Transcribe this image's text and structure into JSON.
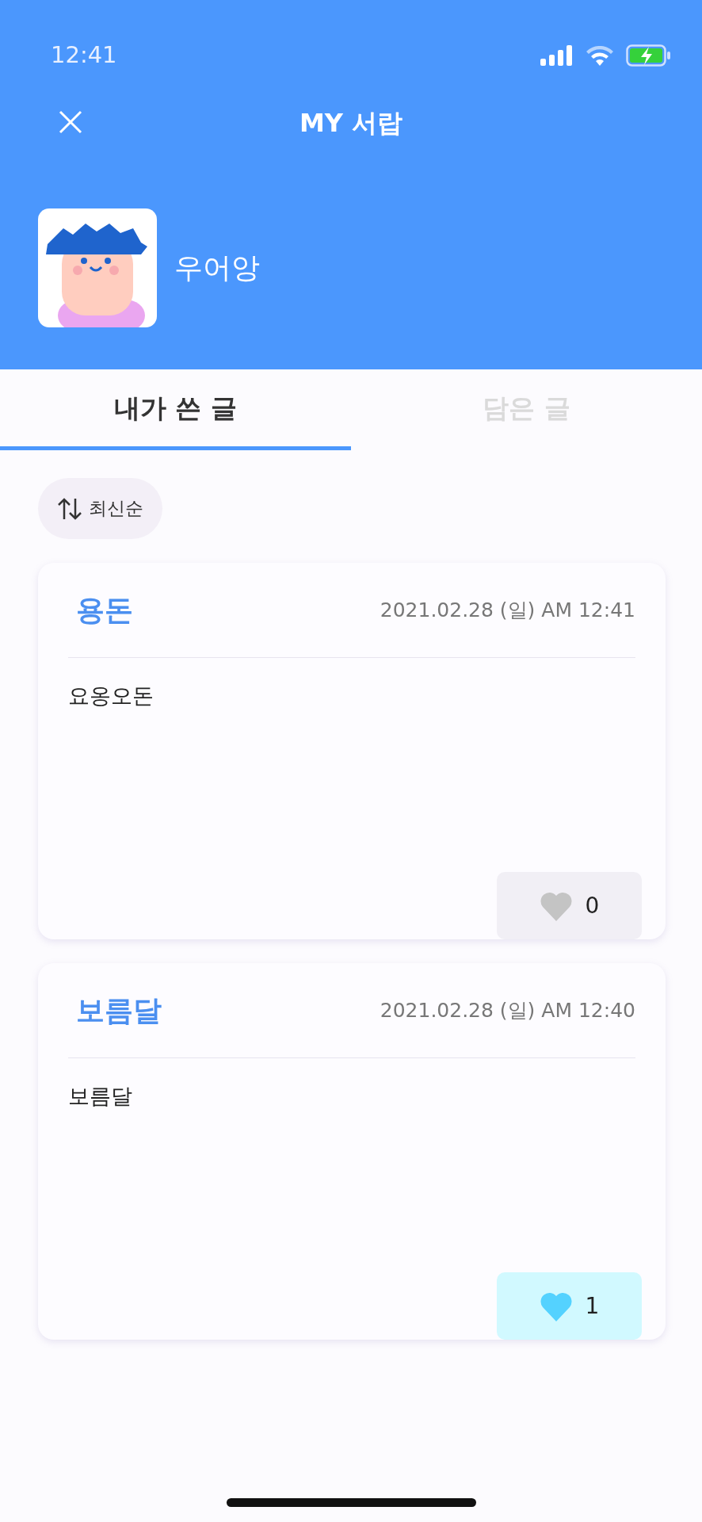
{
  "status_bar": {
    "time": "12:41"
  },
  "header": {
    "title": "MY 서랍",
    "username": "우어앙"
  },
  "tabs": [
    {
      "label": "내가 쓴 글",
      "selected": true
    },
    {
      "label": "담은 글",
      "selected": false
    }
  ],
  "sort": {
    "label": "최신순"
  },
  "posts": [
    {
      "title": "용돈",
      "date": "2021.02.28 (일) AM 12:41",
      "body": "요옹오돈",
      "likes": "0",
      "liked": false
    },
    {
      "title": "보름달",
      "date": "2021.02.28 (일) AM 12:40",
      "body": "보름달",
      "likes": "1",
      "liked": true
    }
  ]
}
